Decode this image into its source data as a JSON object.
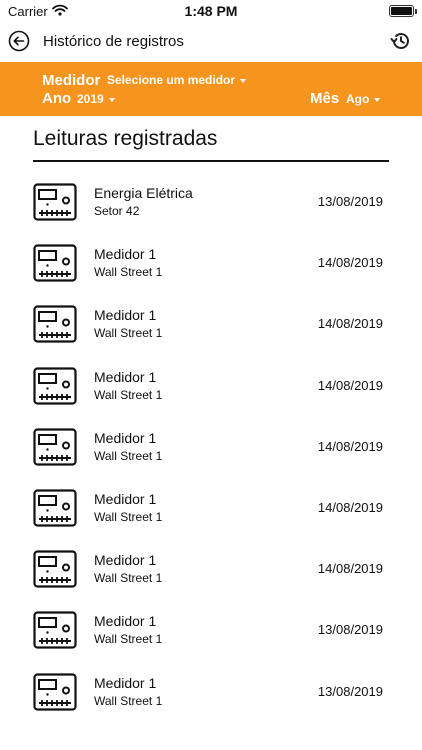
{
  "status": {
    "carrier": "Carrier",
    "time": "1:48 PM",
    "battery_level": 1.0
  },
  "nav": {
    "title": "Histórico de registros",
    "back_icon": "back-arrow-circle-icon",
    "history_icon": "history-clock-icon"
  },
  "filters": {
    "bar_color": "#f7941d",
    "meter_label": "Medidor",
    "meter_value": "Selecione um medidor",
    "year_label": "Ano",
    "year_value": "2019",
    "month_label": "Mês",
    "month_value": "Ago"
  },
  "section": {
    "title": "Leituras registradas"
  },
  "readings": [
    {
      "title": "Energia Elétrica",
      "subtitle": "Setor 42",
      "date": "13/08/2019"
    },
    {
      "title": "Medidor 1",
      "subtitle": "Wall Street 1",
      "date": "14/08/2019"
    },
    {
      "title": "Medidor 1",
      "subtitle": "Wall Street 1",
      "date": "14/08/2019"
    },
    {
      "title": "Medidor 1",
      "subtitle": "Wall Street 1",
      "date": "14/08/2019"
    },
    {
      "title": "Medidor 1",
      "subtitle": "Wall Street 1",
      "date": "14/08/2019"
    },
    {
      "title": "Medidor 1",
      "subtitle": "Wall Street 1",
      "date": "14/08/2019"
    },
    {
      "title": "Medidor 1",
      "subtitle": "Wall Street 1",
      "date": "14/08/2019"
    },
    {
      "title": "Medidor 1",
      "subtitle": "Wall Street 1",
      "date": "13/08/2019"
    },
    {
      "title": "Medidor 1",
      "subtitle": "Wall Street 1",
      "date": "13/08/2019"
    }
  ]
}
